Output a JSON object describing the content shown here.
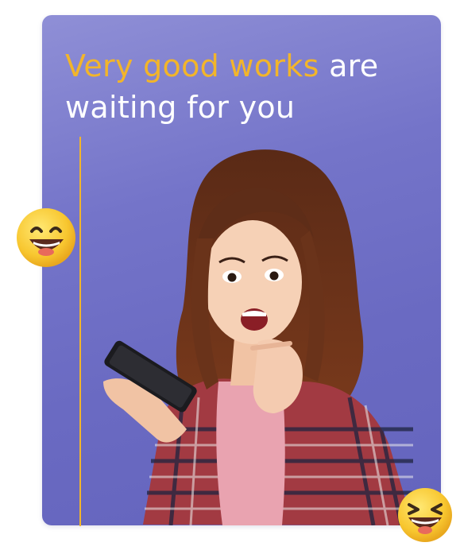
{
  "headline": {
    "accent": "Very good works",
    "rest_line1": " are",
    "line2": "waiting for you"
  },
  "colors": {
    "card_gradient_start": "#8f8fd6",
    "card_gradient_end": "#6464bd",
    "accent": "#f2b52a",
    "text": "#ffffff"
  },
  "icons": {
    "left_emoji": "happy-smiley-icon",
    "right_emoji": "laughing-smiley-icon"
  }
}
